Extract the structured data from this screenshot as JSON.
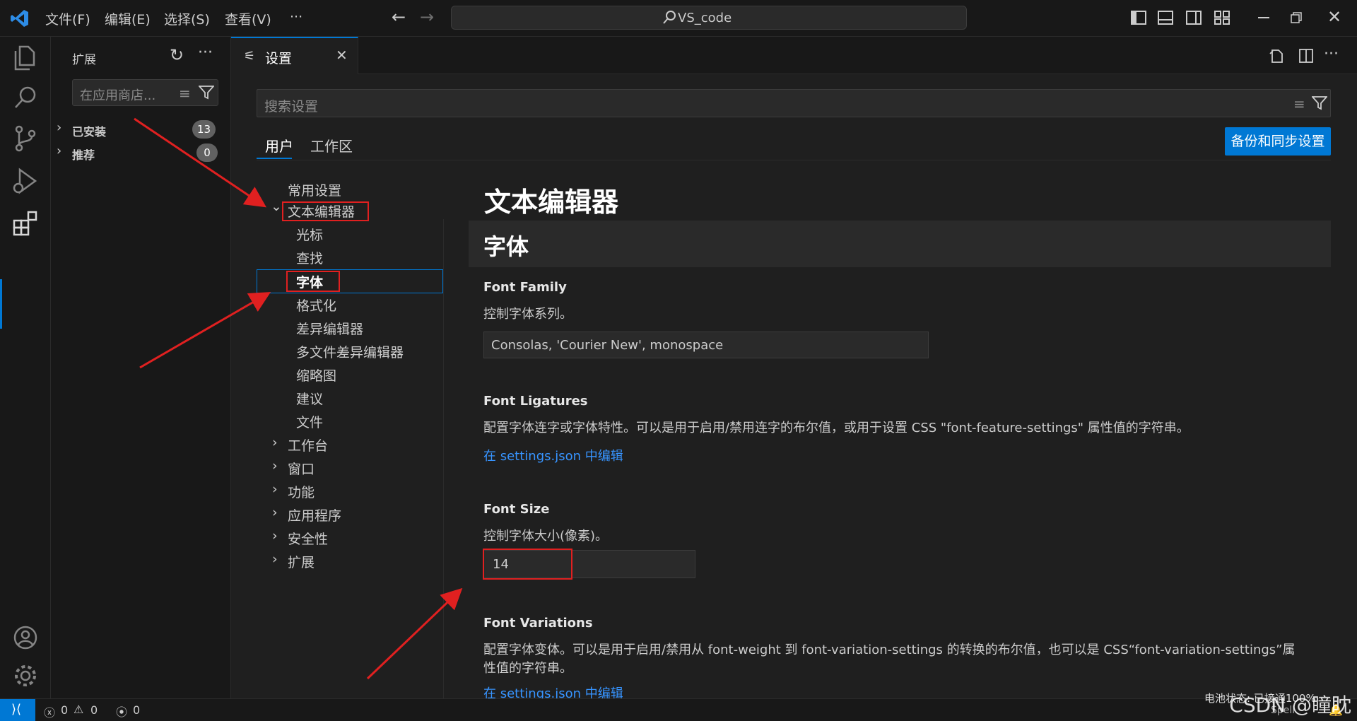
{
  "titlebar": {
    "menus": [
      "文件(F)",
      "编辑(E)",
      "选择(S)",
      "查看(V)",
      "···"
    ],
    "search_text": "VS_code"
  },
  "sidebar": {
    "title": "扩展",
    "search_placeholder": "在应用商店...",
    "sections": [
      {
        "label": "已安装",
        "count": "13"
      },
      {
        "label": "推荐",
        "count": "0"
      }
    ]
  },
  "tab": {
    "label": "设置"
  },
  "settings": {
    "search_placeholder": "搜索设置",
    "scopes": [
      "用户",
      "工作区"
    ],
    "backup_button": "备份和同步设置",
    "toc": {
      "common": "常用设置",
      "text_editor": "文本编辑器",
      "children": [
        "光标",
        "查找",
        "字体",
        "格式化",
        "差异编辑器",
        "多文件差异编辑器",
        "缩略图",
        "建议",
        "文件"
      ],
      "collapsed": [
        "工作台",
        "窗口",
        "功能",
        "应用程序",
        "安全性",
        "扩展"
      ]
    },
    "section_title": "文本编辑器",
    "subsection_title": "字体",
    "items": {
      "font_family": {
        "title": "Font Family",
        "desc": "控制字体系列。",
        "value": "Consolas, 'Courier New', monospace"
      },
      "font_ligatures": {
        "title": "Font Ligatures",
        "desc": "配置字体连字或字体特性。可以是用于启用/禁用连字的布尔值，或用于设置 CSS \"font-feature-settings\" 属性值的字符串。",
        "link": "在 settings.json 中编辑"
      },
      "font_size": {
        "title": "Font Size",
        "desc": "控制字体大小(像素)。",
        "value": "14"
      },
      "font_variations": {
        "title": "Font Variations",
        "desc1": "配置字体变体。可以是用于启用/禁用从 font-weight 到 font-variation-settings 的转换的布尔值，也可以是 CSS“font-variation-settings”属",
        "desc2": "性值的字符串。",
        "link": "在 settings.json 中编辑"
      }
    }
  },
  "statusbar": {
    "errors": "0",
    "warnings": "0",
    "ports": "0",
    "spell": "Spell",
    "watermark": "CSDN @瞳眈",
    "battery_tip": "电池状态: 已接通100%"
  },
  "colors": {
    "accent": "#0078d4",
    "annotation": "#e02020",
    "link": "#3794ff"
  }
}
